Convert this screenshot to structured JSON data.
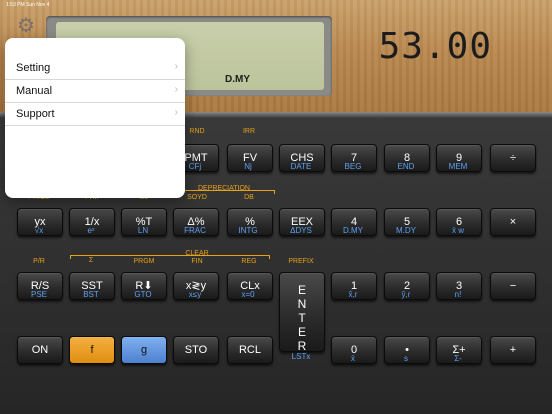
{
  "status_bar": {
    "time": "1:53 PM  Sun Nov 4",
    "right": ""
  },
  "display": {
    "value": "53.00",
    "status": "D.MY"
  },
  "menu": {
    "items": [
      {
        "label": "Setting",
        "chev": "›"
      },
      {
        "label": "Manual",
        "chev": "›"
      },
      {
        "label": "Support",
        "chev": "›"
      }
    ]
  },
  "gold_labels": {
    "rnd": "RND",
    "irr": "IRR",
    "depreciation": "DEPRECIATION",
    "soyd": "SOYD",
    "db": "DB",
    "pval": "PRICE",
    "ytm": "YTM",
    "sl": "SL",
    "pr": "P/R",
    "sigma": "Σ",
    "prgm": "PRGM",
    "clear": "CLEAR",
    "fin": "FIN",
    "reg": "REG",
    "prefix": "PREFIX"
  },
  "row1": [
    {
      "label": "PMT",
      "blue": "CFj"
    },
    {
      "label": "FV",
      "blue": "Nj"
    },
    {
      "label": "CHS",
      "blue": "DATE"
    },
    {
      "label": "7",
      "blue": "BEG"
    },
    {
      "label": "8",
      "blue": "END"
    },
    {
      "label": "9",
      "blue": "MEM"
    },
    {
      "label": "÷",
      "blue": ""
    }
  ],
  "row2": [
    {
      "label": "yx",
      "blue": "√x"
    },
    {
      "label": "1/x",
      "blue": "eˣ"
    },
    {
      "label": "%T",
      "blue": "LN"
    },
    {
      "label": "Δ%",
      "blue": "FRAC"
    },
    {
      "label": "%",
      "blue": "INTG"
    },
    {
      "label": "EEX",
      "blue": "ΔDYS"
    },
    {
      "label": "4",
      "blue": "D.MY"
    },
    {
      "label": "5",
      "blue": "M.DY"
    },
    {
      "label": "6",
      "blue": "x̄ w"
    },
    {
      "label": "×",
      "blue": ""
    }
  ],
  "row3": [
    {
      "label": "R/S",
      "blue": "PSE"
    },
    {
      "label": "SST",
      "blue": "BST"
    },
    {
      "label": "R⬇",
      "blue": "GTO"
    },
    {
      "label": "x≷y",
      "blue": "x≤y"
    },
    {
      "label": "CLx",
      "blue": "x=0"
    },
    {
      "label": "1",
      "blue": "x̂,r"
    },
    {
      "label": "2",
      "blue": "ŷ,r"
    },
    {
      "label": "3",
      "blue": "n!"
    },
    {
      "label": "−",
      "blue": ""
    }
  ],
  "row4": [
    {
      "label": "ON",
      "blue": ""
    },
    {
      "label": "f",
      "blue": ""
    },
    {
      "label": "g",
      "blue": ""
    },
    {
      "label": "STO",
      "blue": ""
    },
    {
      "label": "RCL",
      "blue": ""
    },
    {
      "label": "0",
      "blue": "x̄"
    },
    {
      "label": "•",
      "blue": "s"
    },
    {
      "label": "Σ+",
      "blue": "Σ-"
    },
    {
      "label": "+",
      "blue": ""
    }
  ],
  "enter": {
    "label": "ENTER",
    "blue": "LSTx"
  }
}
